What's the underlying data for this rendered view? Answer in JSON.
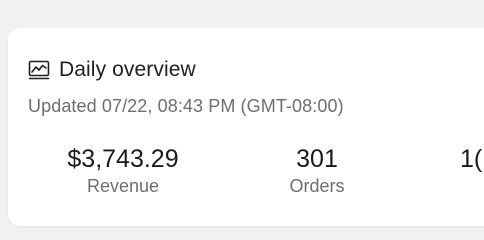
{
  "overview": {
    "title": "Daily overview",
    "icon": "line-chart-icon",
    "updated": "Updated 07/22, 08:43 PM (GMT-08:00)"
  },
  "metrics": [
    {
      "value": "$3,743.29",
      "label": "Revenue"
    },
    {
      "value": "301",
      "label": "Orders"
    },
    {
      "value": "1(",
      "label": ""
    }
  ]
}
